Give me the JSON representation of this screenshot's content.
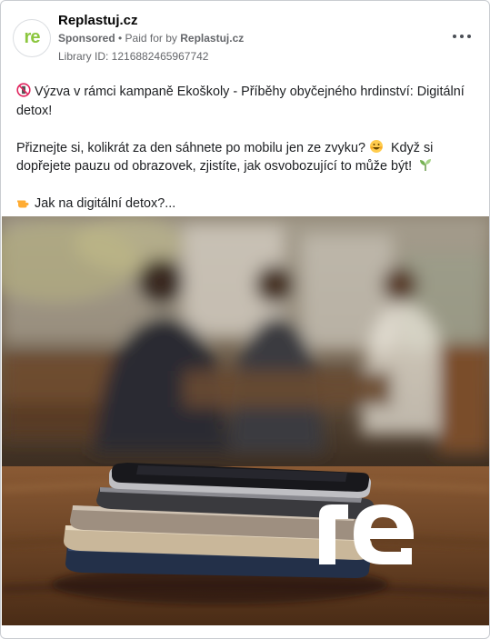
{
  "header": {
    "page_name": "Replastuj.cz",
    "avatar_text": "re",
    "sponsored": "Sponsored",
    "separator": " • ",
    "paid_for_by_prefix": "Paid for by ",
    "paid_for_by": "Replastuj.cz",
    "library_id": "Library ID: 1216882465967742",
    "more_icon": "more-options-icon"
  },
  "post": {
    "para1": "Výzva v rámci kampaně Ekoškoly - Příběhy obyčejného hrdinství: Digitální detox!",
    "para2_a": "Přiznejte si, kolikrát za den sáhnete po mobilu jen ze zvyku? ",
    "para2_b": " Když si dopřejete pauzu od obrazovek, zjistíte, jak osvobozující to může být! ",
    "para3": "Jak na digitální detox?...",
    "icons": [
      "no-phones-icon",
      "grinning-face-icon",
      "seedling-icon",
      "pointing-hand-icon"
    ]
  },
  "image": {
    "description_icon": "phone-stack-photo",
    "logo_text": "re"
  }
}
